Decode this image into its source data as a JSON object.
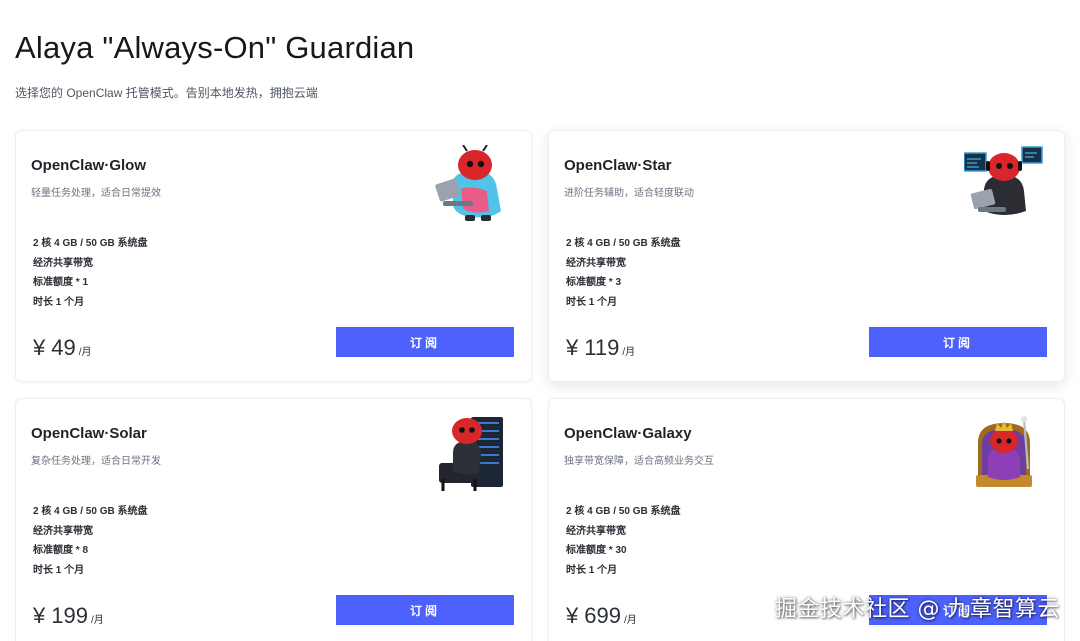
{
  "header": {
    "title": "Alaya \"Always-On\" Guardian",
    "subtitle": "选择您的 OpenClaw 托管模式。告别本地发热，拥抱云端"
  },
  "plans": [
    {
      "name": "OpenClaw·Glow",
      "desc": "轻量任务处理，适合日常提效",
      "features": [
        "2 核 4 GB / 50 GB 系统盘",
        "经济共享带宽",
        "标准额度 * 1",
        "时长 1 个月"
      ],
      "currency": "¥",
      "price": "49",
      "unit": "/月",
      "button": "订阅",
      "mascot": "robot-laptop-hoodie-icon"
    },
    {
      "name": "OpenClaw·Star",
      "desc": "进阶任务辅助，适合轻度联动",
      "features": [
        "2 核 4 GB / 50 GB 系统盘",
        "经济共享带宽",
        "标准额度 * 3",
        "时长 1 个月"
      ],
      "currency": "¥",
      "price": "119",
      "unit": "/月",
      "button": "订阅",
      "mascot": "robot-monitors-icon"
    },
    {
      "name": "OpenClaw·Solar",
      "desc": "复杂任务处理，适合日常开发",
      "features": [
        "2 核 4 GB / 50 GB 系统盘",
        "经济共享带宽",
        "标准额度 * 8",
        "时长 1 个月"
      ],
      "currency": "¥",
      "price": "199",
      "unit": "/月",
      "button": "订阅",
      "mascot": "robot-server-chair-icon"
    },
    {
      "name": "OpenClaw·Galaxy",
      "desc": "独享带宽保障，适合高频业务交互",
      "features": [
        "2 核 4 GB / 50 GB 系统盘",
        "经济共享带宽",
        "标准额度 * 30",
        "时长 1 个月"
      ],
      "currency": "¥",
      "price": "699",
      "unit": "/月",
      "button": "订阅",
      "mascot": "robot-king-throne-icon"
    }
  ],
  "watermark": "掘金技术社区 @ 九章智算云",
  "colors": {
    "accent": "#4d61fc",
    "robot": "#d9262b"
  }
}
